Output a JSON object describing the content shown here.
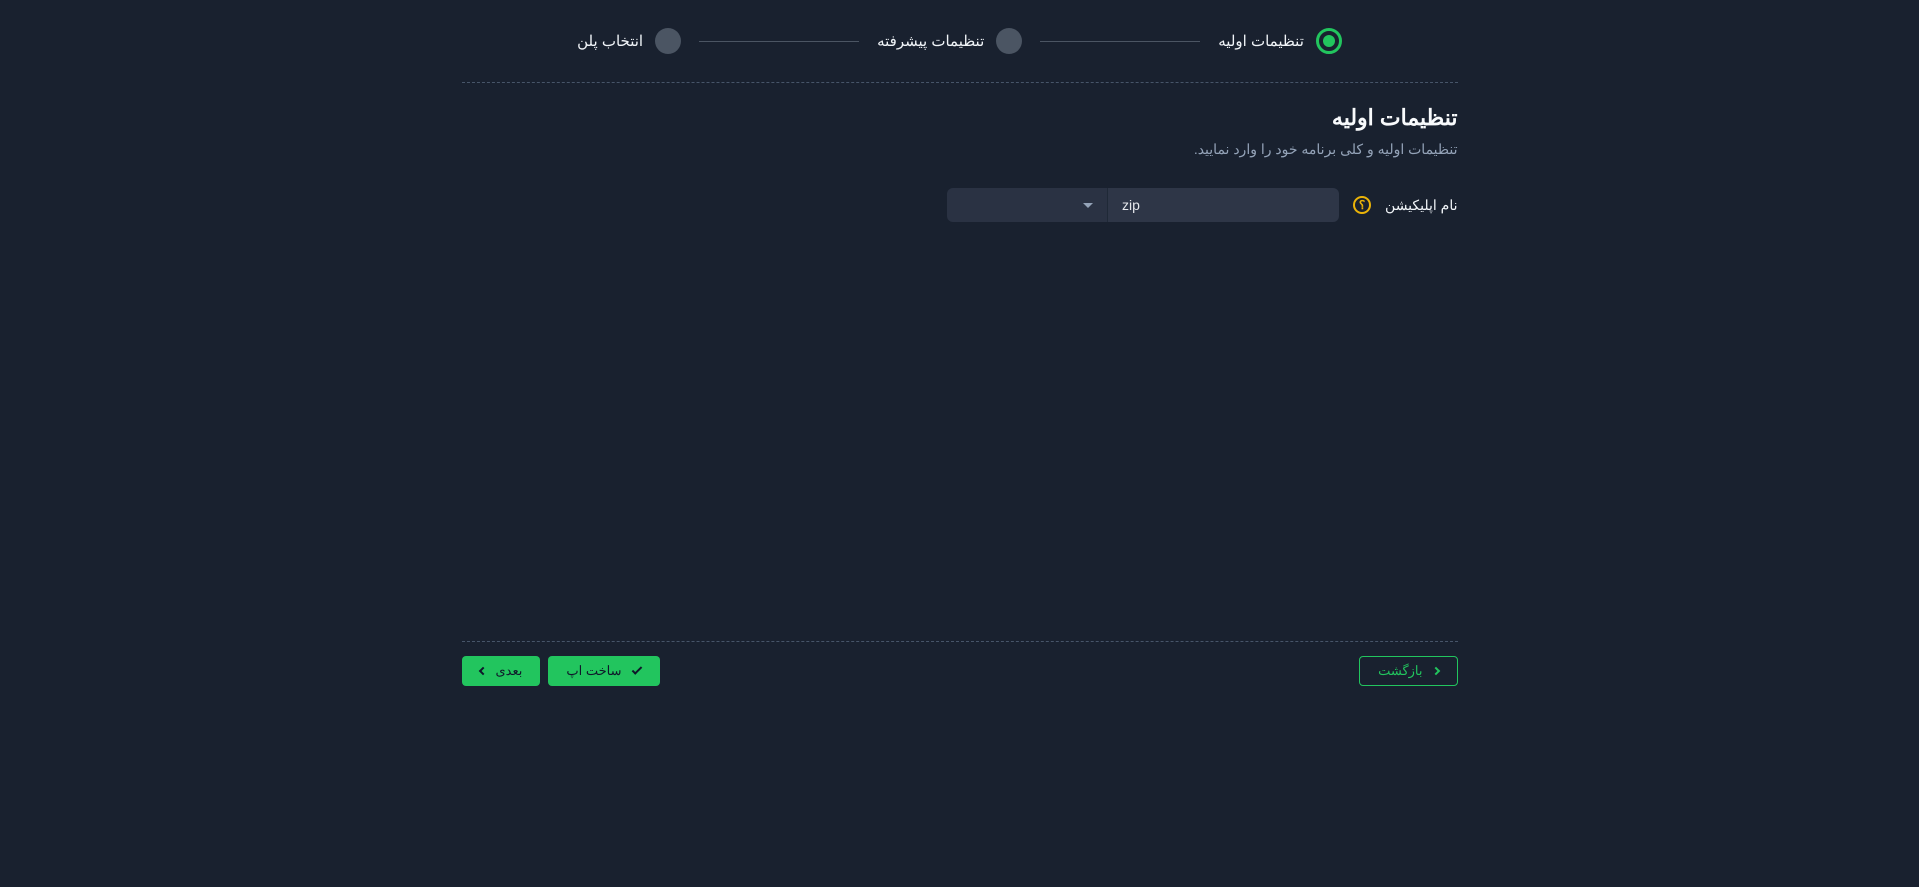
{
  "stepper": {
    "steps": [
      {
        "label": "تنظیمات اولیه",
        "active": true
      },
      {
        "label": "تنظیمات پیشرفته",
        "active": false
      },
      {
        "label": "انتخاب پلن",
        "active": false
      }
    ]
  },
  "section": {
    "title": "تنظیمات اولیه",
    "subtitle": "تنظیمات اولیه و کلی برنامه خود را وارد نمایید."
  },
  "form": {
    "app_name_label": "نام اپلیکیشن",
    "app_name_value": "zip",
    "help_glyph": "؟",
    "select_value": ""
  },
  "footer": {
    "back_label": "بازگشت",
    "create_label": "ساخت اپ",
    "next_label": "بعدی"
  }
}
